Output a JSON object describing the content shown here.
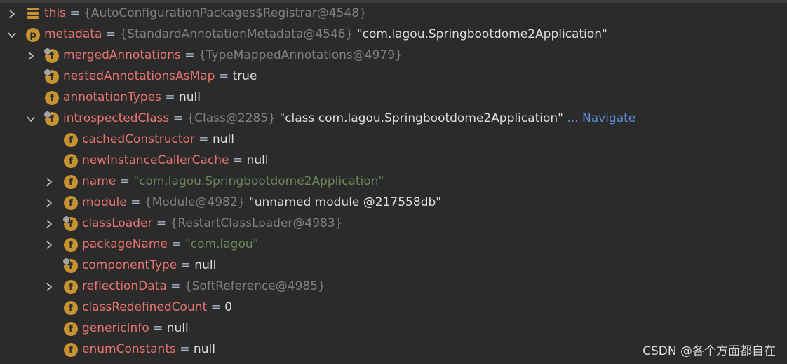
{
  "rows": [
    {
      "chev": "right",
      "icon": "stack",
      "letter": "",
      "lock": false,
      "name": "this",
      "ref": "{AutoConfigurationPackages$Registrar@4548}",
      "val": "",
      "str": "",
      "nav": ""
    },
    {
      "chev": "down",
      "icon": "p",
      "letter": "p",
      "lock": false,
      "name": "metadata",
      "ref": "{StandardAnnotationMetadata@4546}",
      "val": "\"com.lagou.Springbootdome2Application\"",
      "str": "",
      "nav": ""
    },
    {
      "chev": "right",
      "icon": "f",
      "letter": "f",
      "lock": true,
      "name": "mergedAnnotations",
      "ref": "{TypeMappedAnnotations@4979}",
      "val": "",
      "str": "",
      "nav": ""
    },
    {
      "chev": "",
      "icon": "f",
      "letter": "f",
      "lock": true,
      "name": "nestedAnnotationsAsMap",
      "ref": "",
      "val": "true",
      "str": "",
      "nav": ""
    },
    {
      "chev": "",
      "icon": "f",
      "letter": "f",
      "lock": false,
      "name": "annotationTypes",
      "ref": "",
      "val": "null",
      "str": "",
      "nav": ""
    },
    {
      "chev": "down",
      "icon": "f",
      "letter": "f",
      "lock": true,
      "name": "introspectedClass",
      "ref": "{Class@2285}",
      "val": "\"class com.lagou.Springbootdome2Application\"",
      "str": "",
      "nav": "... Navigate"
    },
    {
      "chev": "",
      "icon": "f",
      "letter": "f",
      "lock": false,
      "name": "cachedConstructor",
      "ref": "",
      "val": "null",
      "str": "",
      "nav": ""
    },
    {
      "chev": "",
      "icon": "f",
      "letter": "f",
      "lock": false,
      "name": "newInstanceCallerCache",
      "ref": "",
      "val": "null",
      "str": "",
      "nav": ""
    },
    {
      "chev": "right",
      "icon": "f",
      "letter": "f",
      "lock": false,
      "name": "name",
      "ref": "",
      "val": "",
      "str": "\"com.lagou.Springbootdome2Application\"",
      "nav": ""
    },
    {
      "chev": "right",
      "icon": "f",
      "letter": "f",
      "lock": false,
      "name": "module",
      "ref": "{Module@4982}",
      "val": "\"unnamed module @217558db\"",
      "str": "",
      "nav": ""
    },
    {
      "chev": "right",
      "icon": "f",
      "letter": "f",
      "lock": true,
      "name": "classLoader",
      "ref": "{RestartClassLoader@4983}",
      "val": "",
      "str": "",
      "nav": ""
    },
    {
      "chev": "right",
      "icon": "f",
      "letter": "f",
      "lock": false,
      "name": "packageName",
      "ref": "",
      "val": "",
      "str": "\"com.lagou\"",
      "nav": ""
    },
    {
      "chev": "",
      "icon": "f",
      "letter": "f",
      "lock": true,
      "name": "componentType",
      "ref": "",
      "val": "null",
      "str": "",
      "nav": ""
    },
    {
      "chev": "right",
      "icon": "f",
      "letter": "f",
      "lock": false,
      "name": "reflectionData",
      "ref": "{SoftReference@4985}",
      "val": "",
      "str": "",
      "nav": ""
    },
    {
      "chev": "",
      "icon": "f",
      "letter": "f",
      "lock": false,
      "name": "classRedefinedCount",
      "ref": "",
      "val": "0",
      "str": "",
      "nav": ""
    },
    {
      "chev": "",
      "icon": "f",
      "letter": "f",
      "lock": false,
      "name": "genericInfo",
      "ref": "",
      "val": "null",
      "str": "",
      "nav": ""
    },
    {
      "chev": "",
      "icon": "f",
      "letter": "f",
      "lock": false,
      "name": "enumConstants",
      "ref": "",
      "val": "null",
      "str": "",
      "nav": ""
    }
  ],
  "watermark": "CSDN @各个方面都自在"
}
